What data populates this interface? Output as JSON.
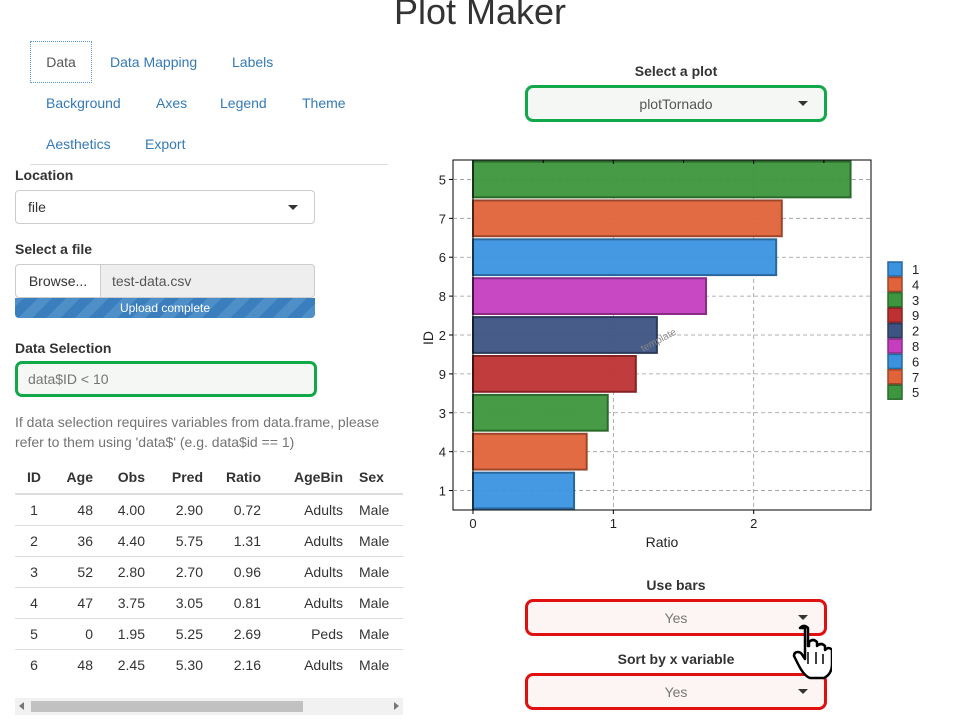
{
  "app_title": "Plot Maker",
  "tabs": [
    {
      "label": "Data",
      "active": true
    },
    {
      "label": "Data Mapping",
      "active": false
    },
    {
      "label": "Labels",
      "active": false
    },
    {
      "label": "Background",
      "active": false
    },
    {
      "label": "Axes",
      "active": false
    },
    {
      "label": "Legend",
      "active": false
    },
    {
      "label": "Theme",
      "active": false
    },
    {
      "label": "Aesthetics",
      "active": false
    },
    {
      "label": "Export",
      "active": false
    }
  ],
  "location": {
    "label": "Location",
    "value": "file"
  },
  "file_select": {
    "label": "Select a file",
    "browse_label": "Browse...",
    "file_name": "test-data.csv",
    "progress_text": "Upload complete",
    "progress": 1.0
  },
  "data_selection": {
    "label": "Data Selection",
    "placeholder": "data$ID < 10",
    "highlight_color": "#11a84a"
  },
  "help_text": "If data selection requires variables from data.frame, please refer to them using 'data$' (e.g. data$id == 1)",
  "table": {
    "columns": [
      "ID",
      "Age",
      "Obs",
      "Pred",
      "Ratio",
      "AgeBin",
      "Sex"
    ],
    "rows": [
      [
        "1",
        "48",
        "4.00",
        "2.90",
        "0.72",
        "Adults",
        "Male"
      ],
      [
        "2",
        "36",
        "4.40",
        "5.75",
        "1.31",
        "Adults",
        "Male"
      ],
      [
        "3",
        "52",
        "2.80",
        "2.70",
        "0.96",
        "Adults",
        "Male"
      ],
      [
        "4",
        "47",
        "3.75",
        "3.05",
        "0.81",
        "Adults",
        "Male"
      ],
      [
        "5",
        "0",
        "1.95",
        "5.25",
        "2.69",
        "Peds",
        "Male"
      ],
      [
        "6",
        "48",
        "2.45",
        "5.30",
        "2.16",
        "Adults",
        "Male"
      ]
    ]
  },
  "select_plot": {
    "label": "Select a plot",
    "value": "plotTornado",
    "highlight_color": "#11a84a"
  },
  "use_bars": {
    "label": "Use bars",
    "value": "Yes",
    "highlight_color": "#e01010"
  },
  "sort_by_x": {
    "label": "Sort by x variable",
    "value": "Yes",
    "highlight_color": "#e01010"
  },
  "chart_data": {
    "type": "bar",
    "orientation": "horizontal",
    "xlabel": "Ratio",
    "ylabel": "ID",
    "categories": [
      "5",
      "7",
      "6",
      "8",
      "2",
      "9",
      "3",
      "4",
      "1"
    ],
    "values": [
      2.69,
      2.2,
      2.16,
      1.66,
      1.31,
      1.16,
      0.96,
      0.81,
      0.72
    ],
    "bar_colors": [
      "#3d963d",
      "#e0633a",
      "#3b93e0",
      "#c53ec0",
      "#3d5382",
      "#be3133",
      "#3d963d",
      "#e0633a",
      "#3b93e0"
    ],
    "xlim": [
      0,
      2.8
    ],
    "xticks": [
      "0",
      "1",
      "2"
    ],
    "grid": true,
    "watermark": "template",
    "legend": {
      "position": "right",
      "entries": [
        {
          "label": "1",
          "color": "#3b93e0"
        },
        {
          "label": "4",
          "color": "#e0633a"
        },
        {
          "label": "3",
          "color": "#3d963d"
        },
        {
          "label": "9",
          "color": "#be3133"
        },
        {
          "label": "2",
          "color": "#3d5382"
        },
        {
          "label": "8",
          "color": "#c53ec0"
        },
        {
          "label": "6",
          "color": "#3b93e0"
        },
        {
          "label": "7",
          "color": "#e0633a"
        },
        {
          "label": "5",
          "color": "#3d963d"
        }
      ]
    }
  }
}
